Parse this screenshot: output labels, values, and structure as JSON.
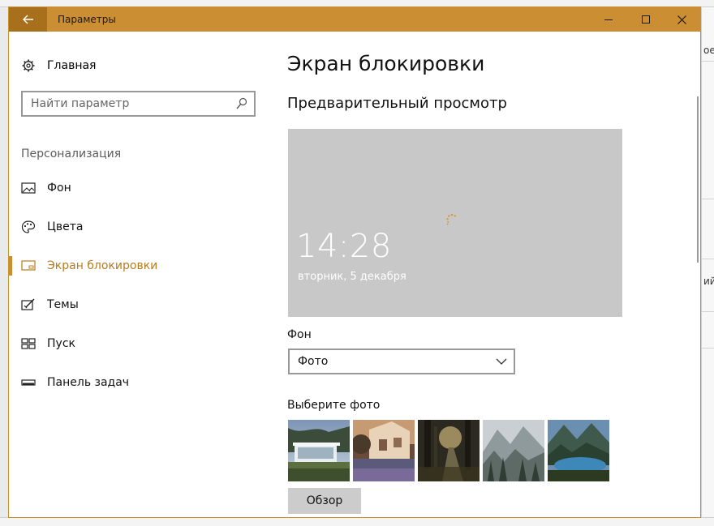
{
  "window": {
    "title": "Параметры",
    "back_icon": "arrow-left-icon",
    "minimize_icon": "minimize-icon",
    "maximize_icon": "maximize-icon",
    "close_icon": "close-icon",
    "accent_color": "#cc8e33"
  },
  "background": {
    "fragments": [
      "ое",
      "ий а"
    ]
  },
  "sidebar": {
    "home_label": "Главная",
    "home_icon": "gear-icon",
    "search_placeholder": "Найти параметр",
    "search_icon": "search-icon",
    "section_label": "Персонализация",
    "items": [
      {
        "label": "Фон",
        "icon": "picture-icon",
        "active": false
      },
      {
        "label": "Цвета",
        "icon": "palette-icon",
        "active": false
      },
      {
        "label": "Экран блокировки",
        "icon": "lock-screen-icon",
        "active": true
      },
      {
        "label": "Темы",
        "icon": "themes-icon",
        "active": false
      },
      {
        "label": "Пуск",
        "icon": "start-icon",
        "active": false
      },
      {
        "label": "Панель задач",
        "icon": "taskbar-icon",
        "active": false
      }
    ]
  },
  "main": {
    "title": "Экран блокировки",
    "preview_title": "Предварительный просмотр",
    "preview": {
      "time": "14:28",
      "date": "вторник, 5 декабря",
      "spinner_icon": "loading-spinner-icon"
    },
    "background_label": "Фон",
    "background_select": {
      "value": "Фото",
      "icon": "chevron-down-icon"
    },
    "choose_photo_label": "Выберите фото",
    "photos": [
      "modern-house-photo",
      "garden-house-photo",
      "forest-road-photo",
      "misty-mountains-photo",
      "mountain-lake-photo"
    ],
    "browse_label": "Обзор"
  }
}
